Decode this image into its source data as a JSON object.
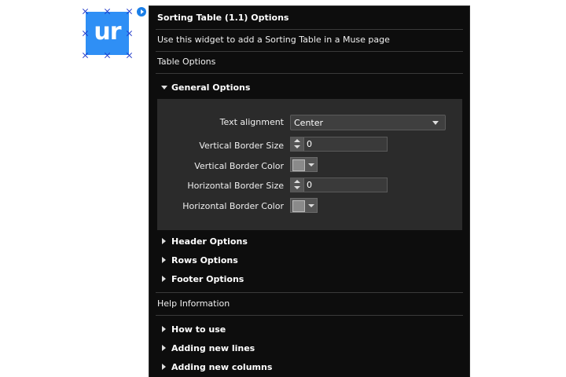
{
  "widget": {
    "logo_text": "ur",
    "colors": {
      "icon_bg": "#2f8ff5",
      "handles": "#1a35c8",
      "play": "#1a7fe8"
    }
  },
  "panel": {
    "title": "Sorting Table (1.1) Options",
    "description": "Use this widget to add a Sorting Table in a Muse page",
    "table_options_label": "Table Options",
    "general": {
      "label": "General Options",
      "expanded": true,
      "fields": {
        "text_alignment": {
          "label": "Text alignment",
          "value": "Center"
        },
        "vertical_border_size": {
          "label": "Vertical Border Size",
          "value": "0"
        },
        "vertical_border_color": {
          "label": "Vertical Border Color"
        },
        "horizontal_border_size": {
          "label": "Horizontal Border Size",
          "value": "0"
        },
        "horizontal_border_color": {
          "label": "Horizontal Border Color"
        }
      }
    },
    "sections": [
      "Header Options",
      "Rows Options",
      "Footer Options"
    ],
    "help_label": "Help Information",
    "help_sections": [
      "How to use",
      "Adding new lines",
      "Adding new columns"
    ],
    "colors": {
      "panel_bg": "#0d0d0d",
      "group_bg": "#2b2b2b"
    }
  }
}
